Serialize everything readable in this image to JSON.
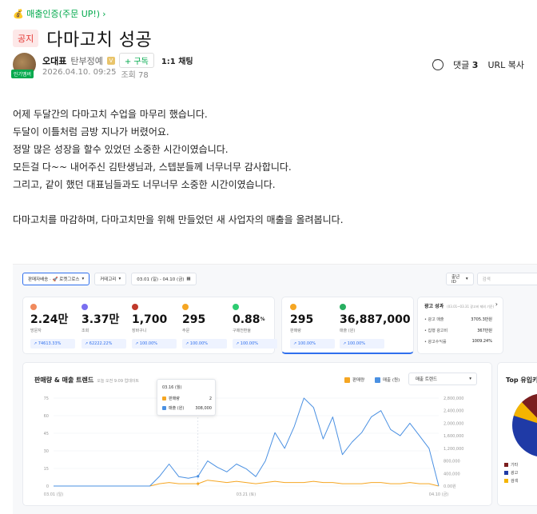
{
  "board": {
    "name": "💰 매출인증(주문 UP!)",
    "chevron": "›"
  },
  "post": {
    "badge": "공지",
    "title": "다마고치 성공",
    "author": {
      "name": "오대표",
      "grade": "탄부정예",
      "grade_icon": "V",
      "follow_label": "+ 구독",
      "chat_label": "1:1 채팅",
      "avatar_badge": "인기멤버"
    },
    "date": "2026.04.10. 09:25",
    "views": "조회 78",
    "comments_label": "댓글",
    "comments_count": "3",
    "url_copy": "URL 복사",
    "body": [
      "어제 두달간의 다마고치 수업을 마무리 했습니다.",
      "두달이 이틀처럼 금방 지나가 버렸어요.",
      "정말 많은 성장을 할수 있었던 소중한 시간이였습니다.",
      "모든걸 다~~  내어주신 김탄생님과, 스텝분들께 너무너무 감사합니다.",
      "그리고, 같이 했던 대표님들과도 너무너무 소중한 시간이였습니다.",
      "",
      "다마고치를 마감하며, 다마고치만을 위해 만들었던 새 사업자의 매출을 올려봅니다."
    ]
  },
  "dashboard": {
    "store_select": "판매자배송 · 🚀 로켓그로스",
    "period_select": "커테고리",
    "date_range": "03.01 (일) - 04.10 (금)",
    "calendar_icon": "calendar-icon",
    "seller_select": "출년 ID",
    "search_placeholder": "검색",
    "metrics": [
      {
        "value": "2.24만",
        "label": "방문자",
        "chip": "↗ 74613.33%",
        "color": "#f08a5d"
      },
      {
        "value": "3.37만",
        "label": "조회",
        "chip": "↗ 62222.22%",
        "color": "#7a6ff0"
      },
      {
        "value": "1,700",
        "label": "장바구니",
        "chip": "↗ 100.00%",
        "color": "#c0392b"
      },
      {
        "value": "295",
        "label": "주문",
        "chip": "↗ 100.00%",
        "color": "#f5a623"
      },
      {
        "value": "0.88",
        "unit": "%",
        "label": "구매전환율",
        "chip": "↗ 100.00%",
        "color": "#2ecc71"
      }
    ],
    "sales": [
      {
        "value": "295",
        "label": "판매량",
        "chip": "↗ 100.00%",
        "color": "#f5a623"
      },
      {
        "value": "36,887,000",
        "label": "매출 (원)",
        "chip": "↗ 100.00%",
        "color": "#27ae60"
      }
    ],
    "ad": {
      "title": "광고 성과",
      "subtitle": "(03.01~03.31 광고비 제외 기준)",
      "arrow": "›",
      "rows": [
        {
          "label": "• 광고 매출",
          "value": "3705.3만원"
        },
        {
          "label": "• 집행 광고비",
          "value": "367만원"
        },
        {
          "label": "• 광고수익률",
          "value": "1009.24%"
        }
      ]
    },
    "trend": {
      "title": "판매량 & 매출 트렌드",
      "subtitle": "오늘 오전 9:09 업데이트",
      "legend_qty": "판매량",
      "legend_rev": "매출 (원)",
      "select_label": "매출 트렌드",
      "tooltip": {
        "date": "03.16 (월)",
        "qty_label": "판매량",
        "qty_value": "2",
        "rev_label": "매출 (원)",
        "rev_value": "308,000"
      }
    },
    "top": {
      "title": "Top 유입키",
      "legend": [
        {
          "label": "기타",
          "color": "#7b1e1e"
        },
        {
          "label": "광고",
          "color": "#1f3aa6"
        },
        {
          "label": "검색",
          "color": "#f4b400"
        }
      ]
    }
  },
  "chart_data": {
    "type": "line",
    "title": "판매량 & 매출 트렌드",
    "x_tick_labels": [
      "03.01 (일)",
      "03.21 (토)",
      "04.10 (금)"
    ],
    "x": [
      "03.01",
      "03.02",
      "03.03",
      "03.04",
      "03.05",
      "03.06",
      "03.07",
      "03.08",
      "03.09",
      "03.10",
      "03.11",
      "03.12",
      "03.13",
      "03.14",
      "03.15",
      "03.16",
      "03.17",
      "03.18",
      "03.19",
      "03.20",
      "03.21",
      "03.22",
      "03.23",
      "03.24",
      "03.25",
      "03.26",
      "03.27",
      "03.28",
      "03.29",
      "03.30",
      "03.31",
      "04.01",
      "04.02",
      "04.03",
      "04.04",
      "04.05",
      "04.06",
      "04.07",
      "04.08",
      "04.09",
      "04.10"
    ],
    "y_left_ticks": [
      "0",
      "15",
      "30",
      "45",
      "60",
      "75"
    ],
    "y_right_ticks": [
      "0.00원",
      "400,000",
      "800,000",
      "1,200,000",
      "1,600,000",
      "2,000,000",
      "2,400,000",
      "2,800,000"
    ],
    "ylim_left": [
      0,
      75
    ],
    "ylim_right": [
      0,
      2800000
    ],
    "series": [
      {
        "name": "판매량",
        "axis": "left",
        "color": "#f5a623",
        "values": [
          0,
          0,
          0,
          0,
          0,
          0,
          0,
          0,
          0,
          0,
          0,
          2,
          3,
          2,
          2,
          2,
          5,
          4,
          3,
          4,
          3,
          2,
          3,
          4,
          3,
          3,
          3,
          4,
          3,
          3,
          2,
          2,
          2,
          3,
          3,
          2,
          2,
          3,
          2,
          2,
          0
        ]
      },
      {
        "name": "매출 (원)",
        "axis": "right",
        "color": "#4a90e2",
        "values": [
          0,
          0,
          0,
          0,
          0,
          0,
          0,
          0,
          0,
          0,
          0,
          308000,
          700000,
          300000,
          250000,
          308000,
          800000,
          600000,
          450000,
          700000,
          550000,
          300000,
          800000,
          1700000,
          1200000,
          1900000,
          2800000,
          2500000,
          1500000,
          2200000,
          1000000,
          1400000,
          1700000,
          2200000,
          2400000,
          1800000,
          1600000,
          2000000,
          1600000,
          1200000,
          0
        ]
      }
    ],
    "highlight": {
      "x": "03.16",
      "qty": 2,
      "rev": 308000
    }
  }
}
